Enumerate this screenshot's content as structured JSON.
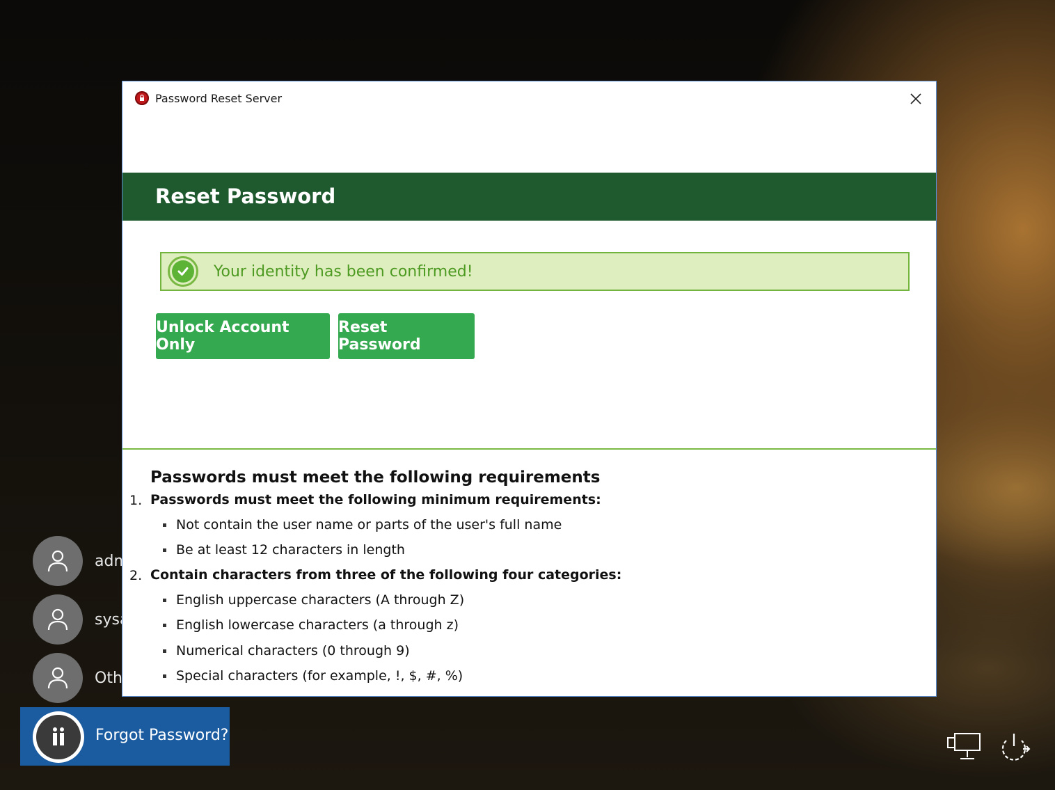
{
  "window": {
    "title": "Password Reset Server",
    "close_icon": "close-icon"
  },
  "banner": {
    "title": "Reset Password",
    "color": "#1e5a2e"
  },
  "confirmation": {
    "message": "Your identity has been confirmed!",
    "icon": "check-circle-icon"
  },
  "actions": {
    "unlock_label": "Unlock Account Only",
    "reset_label": "Reset Password",
    "color": "#34a94f"
  },
  "requirements": {
    "heading": "Passwords must meet the following requirements",
    "items": [
      {
        "number": "1.",
        "title": "Passwords must meet the following minimum requirements:",
        "bullets": [
          "Not contain the user name or parts of the user's full name",
          "Be at least 12 characters in length"
        ]
      },
      {
        "number": "2.",
        "title": "Contain characters from three of the following four categories:",
        "bullets": [
          "English uppercase characters (A through Z)",
          "English lowercase characters (a through z)",
          "Numerical characters (0 through 9)",
          "Special characters (for example, !, $, #, %)"
        ]
      }
    ]
  },
  "login_screen": {
    "users": [
      "adm",
      "sysa",
      "Oth"
    ],
    "forgot_password_label": "Forgot Password?",
    "tray_icons": [
      "network-icon",
      "power-icon"
    ]
  }
}
